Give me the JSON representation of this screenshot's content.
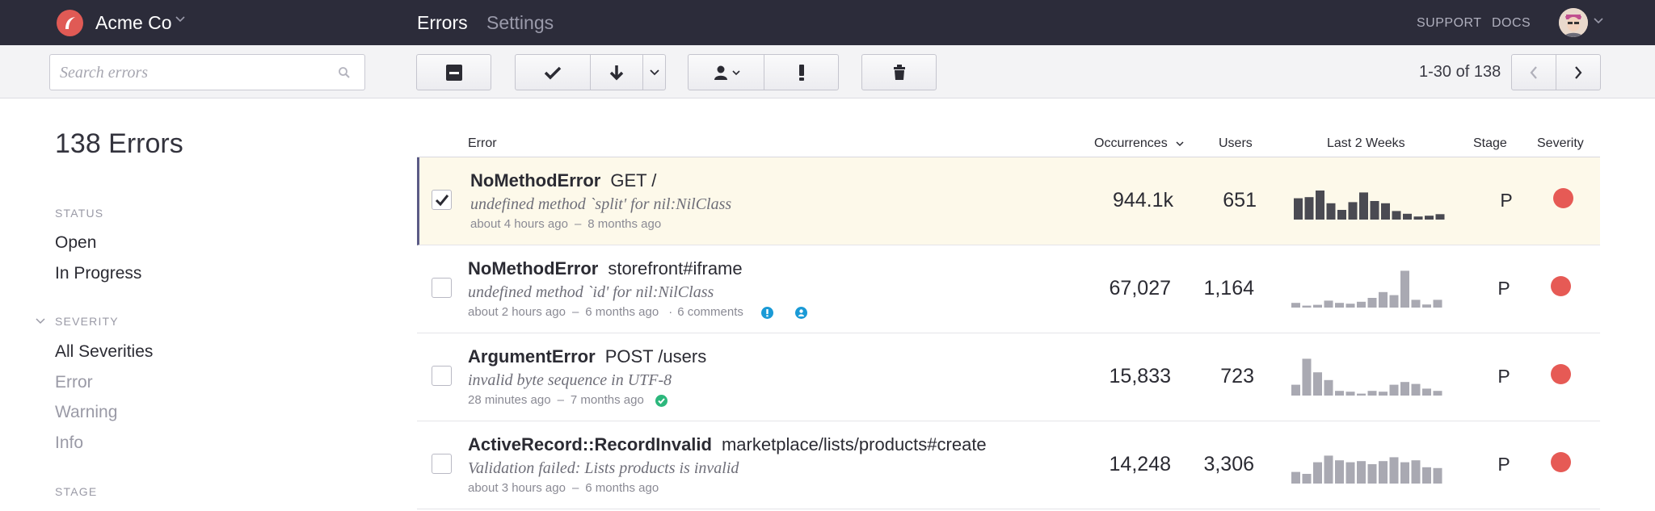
{
  "app": {
    "name": "Acme Co",
    "tabs": [
      "Errors",
      "Settings"
    ],
    "links": {
      "support": "SUPPORT",
      "docs": "DOCS"
    }
  },
  "toolbar": {
    "search_placeholder": "Search errors",
    "pager": "1-30 of 138"
  },
  "sidebar": {
    "title": "138 Errors",
    "status_heading": "STATUS",
    "status_items": [
      "Open",
      "In Progress"
    ],
    "severity_heading": "SEVERITY",
    "severity_items": [
      "All Severities",
      "Error",
      "Warning",
      "Info"
    ],
    "stage_heading": "STAGE"
  },
  "table": {
    "headers": {
      "error": "Error",
      "occurrences": "Occurrences",
      "users": "Users",
      "last2weeks": "Last 2 Weeks",
      "stage": "Stage",
      "severity": "Severity"
    },
    "rows": [
      {
        "class": "NoMethodError",
        "context": "GET /",
        "message": "undefined method `split' for nil:NilClass",
        "last_seen": "about 4 hours ago",
        "first_seen": "8 months ago",
        "extra": "",
        "occurrences": "944.1k",
        "users": "651",
        "stage": "P",
        "selected": true,
        "spark": [
          0.55,
          0.58,
          0.75,
          0.42,
          0.25,
          0.45,
          0.7,
          0.48,
          0.42,
          0.22,
          0.15,
          0.08,
          0.1,
          0.14
        ],
        "spark_color": "#4a4a52"
      },
      {
        "class": "NoMethodError",
        "context": "storefront#iframe",
        "message": "undefined method `id' for nil:NilClass",
        "last_seen": "about 2 hours ago",
        "first_seen": "6 months ago",
        "extra": "6 comments",
        "occurrences": "67,027",
        "users": "1,164",
        "stage": "P",
        "selected": false,
        "spark": [
          0.12,
          0.05,
          0.07,
          0.18,
          0.12,
          0.1,
          0.15,
          0.25,
          0.4,
          0.32,
          0.95,
          0.2,
          0.08,
          0.2
        ],
        "spark_color": "#a9a9b2"
      },
      {
        "class": "ArgumentError",
        "context": "POST /users",
        "message": "invalid byte sequence in UTF-8",
        "last_seen": "28 minutes ago",
        "first_seen": "7 months ago",
        "extra": "",
        "occurrences": "15,833",
        "users": "723",
        "stage": "P",
        "selected": false,
        "spark": [
          0.28,
          0.95,
          0.6,
          0.4,
          0.12,
          0.1,
          0.05,
          0.12,
          0.1,
          0.28,
          0.35,
          0.3,
          0.18,
          0.12
        ],
        "spark_color": "#a9a9b2"
      },
      {
        "class": "ActiveRecord::RecordInvalid",
        "context": "marketplace/lists/products#create",
        "message": "Validation failed: Lists products is invalid",
        "last_seen": "about 3 hours ago",
        "first_seen": "6 months ago",
        "extra": "",
        "occurrences": "14,248",
        "users": "3,306",
        "stage": "P",
        "selected": false,
        "spark": [
          0.3,
          0.25,
          0.55,
          0.72,
          0.6,
          0.55,
          0.58,
          0.5,
          0.58,
          0.68,
          0.55,
          0.6,
          0.42,
          0.4
        ],
        "spark_color": "#a9a9b2"
      }
    ]
  },
  "colors": {
    "nav": "#2c2c3a",
    "accent": "#e05a55",
    "severity_error": "#e65a55",
    "selected_row": "#fdf9ea"
  }
}
